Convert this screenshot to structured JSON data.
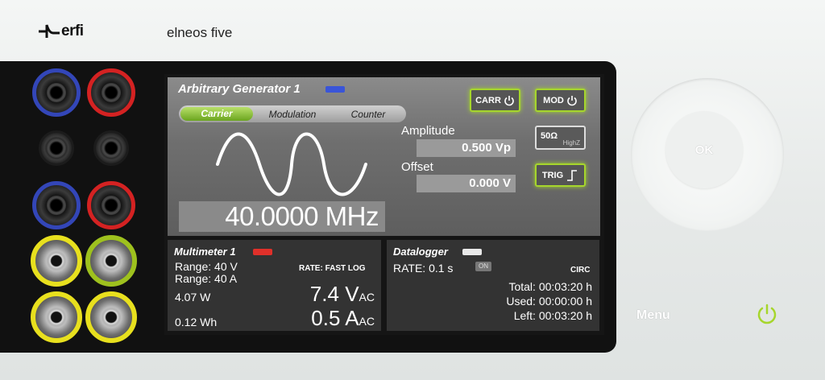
{
  "brand": {
    "logo_text": "erfi",
    "model": "elneos five"
  },
  "generator": {
    "title": "Arbitrary Generator 1",
    "tabs": [
      "Carrier",
      "Modulation",
      "Counter"
    ],
    "active_tab": "Carrier",
    "frequency": "40.0000 MHz",
    "amplitude_label": "Amplitude",
    "amplitude_value": "0.500 Vp",
    "offset_label": "Offset",
    "offset_value": "0.000 V",
    "carr_button": "CARR",
    "mod_button": "MOD",
    "impedance_button": "50Ω",
    "impedance_sub": "HighZ",
    "trig_button": "TRIG",
    "indicator_color": "#3a55d8"
  },
  "multimeter": {
    "title": "Multimeter 1",
    "range_v": "Range: 40 V",
    "range_a": "Range: 40 A",
    "rate": "RATE: FAST LOG",
    "power": "4.07 W",
    "energy": "0.12 Wh",
    "voltage_value": "7.4 V",
    "voltage_unit": "AC",
    "current_value": "0.5 A",
    "current_unit": "AC",
    "indicator_color": "#e0302a"
  },
  "datalogger": {
    "title": "Datalogger",
    "rate": "RATE: 0.1 s",
    "on_badge": "ON",
    "mode": "CIRC",
    "total": "Total: 00:03:20 h",
    "used": "Used: 00:00:00 h",
    "left": "Left: 00:03:20 h",
    "indicator_color": "#e8e8e8"
  },
  "controls": {
    "ok_label": "OK",
    "menu_label": "Menu",
    "power_color": "#a6d62c"
  },
  "jacks": [
    {
      "name": "jack-1-blue",
      "color": "blue"
    },
    {
      "name": "jack-1-red",
      "color": "red"
    },
    {
      "name": "jack-2-black-left",
      "color": "none"
    },
    {
      "name": "jack-2-black-right",
      "color": "none"
    },
    {
      "name": "jack-3-blue",
      "color": "blue"
    },
    {
      "name": "jack-3-red",
      "color": "red"
    },
    {
      "name": "bnc-1-yellow",
      "color": "yellow"
    },
    {
      "name": "bnc-1-green",
      "color": "green"
    },
    {
      "name": "bnc-2-yellow",
      "color": "yellow"
    },
    {
      "name": "bnc-2-yellow-right",
      "color": "yellow"
    }
  ]
}
